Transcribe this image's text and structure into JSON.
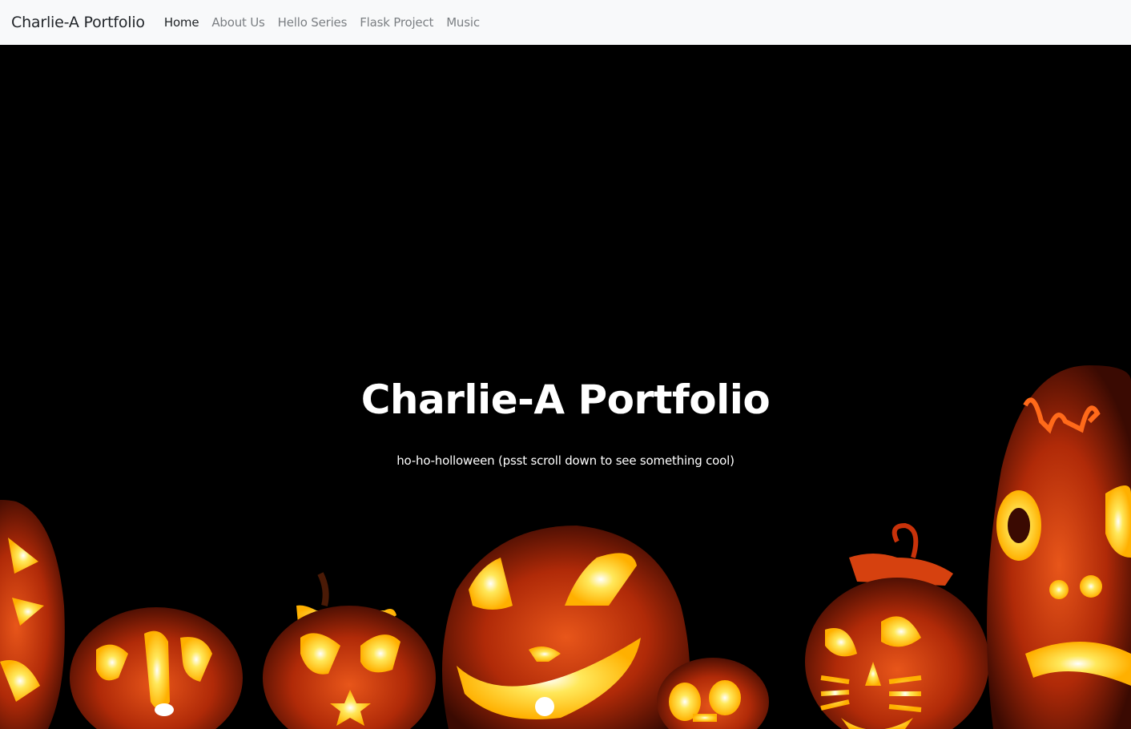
{
  "navbar": {
    "brand": "Charlie-A Portfolio",
    "links": [
      {
        "label": "Home",
        "active": true
      },
      {
        "label": "About Us",
        "active": false
      },
      {
        "label": "Hello Series",
        "active": false
      },
      {
        "label": "Flask Project",
        "active": false
      },
      {
        "label": "Music",
        "active": false
      }
    ]
  },
  "hero": {
    "title": "Charlie-A Portfolio",
    "subtitle": "ho-ho-holloween (psst scroll down to see something cool)",
    "background_image": "halloween-jack-o-lanterns"
  },
  "colors": {
    "navbar_bg": "#f8f9fa",
    "hero_bg": "#000000",
    "active_link": "#1d2124",
    "inactive_link": "#7b7f83",
    "pumpkin_glow": "#ffd21a",
    "pumpkin_body": "#c8320a"
  }
}
